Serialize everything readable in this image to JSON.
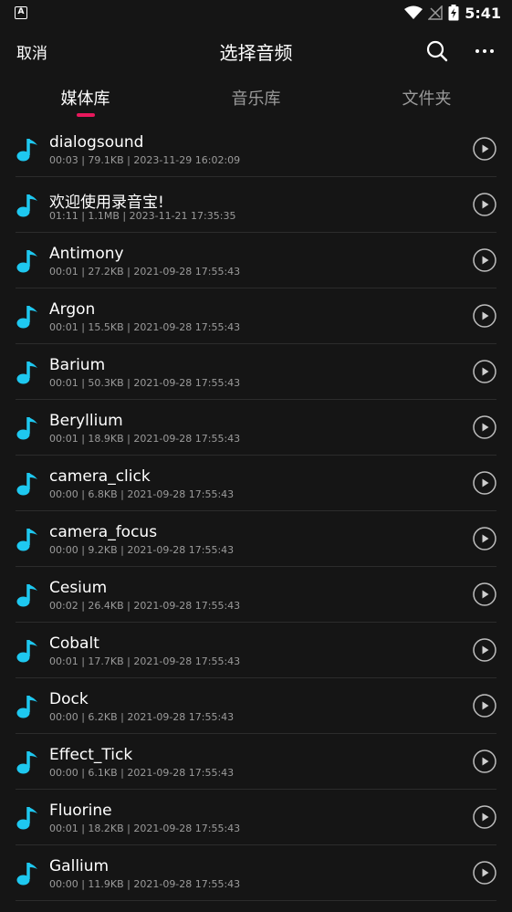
{
  "status": {
    "time": "5:41"
  },
  "toolbar": {
    "cancel_label": "取消",
    "title": "选择音频"
  },
  "tabs": [
    {
      "label": "媒体库",
      "active": true
    },
    {
      "label": "音乐库",
      "active": false
    },
    {
      "label": "文件夹",
      "active": false
    }
  ],
  "accent_color": "#e8185c",
  "icon_color": "#1ec8f0",
  "items": [
    {
      "name": "dialogsound",
      "meta": "00:03 | 79.1KB | 2023-11-29 16:02:09"
    },
    {
      "name": "欢迎使用录音宝!",
      "meta": "01:11 | 1.1MB | 2023-11-21 17:35:35"
    },
    {
      "name": "Antimony",
      "meta": "00:01 | 27.2KB | 2021-09-28 17:55:43"
    },
    {
      "name": "Argon",
      "meta": "00:01 | 15.5KB | 2021-09-28 17:55:43"
    },
    {
      "name": "Barium",
      "meta": "00:01 | 50.3KB | 2021-09-28 17:55:43"
    },
    {
      "name": "Beryllium",
      "meta": "00:01 | 18.9KB | 2021-09-28 17:55:43"
    },
    {
      "name": "camera_click",
      "meta": "00:00 | 6.8KB | 2021-09-28 17:55:43"
    },
    {
      "name": "camera_focus",
      "meta": "00:00 | 9.2KB | 2021-09-28 17:55:43"
    },
    {
      "name": "Cesium",
      "meta": "00:02 | 26.4KB | 2021-09-28 17:55:43"
    },
    {
      "name": "Cobalt",
      "meta": "00:01 | 17.7KB | 2021-09-28 17:55:43"
    },
    {
      "name": "Dock",
      "meta": "00:00 | 6.2KB | 2021-09-28 17:55:43"
    },
    {
      "name": "Effect_Tick",
      "meta": "00:00 | 6.1KB | 2021-09-28 17:55:43"
    },
    {
      "name": "Fluorine",
      "meta": "00:01 | 18.2KB | 2021-09-28 17:55:43"
    },
    {
      "name": "Gallium",
      "meta": "00:00 | 11.9KB | 2021-09-28 17:55:43"
    }
  ]
}
